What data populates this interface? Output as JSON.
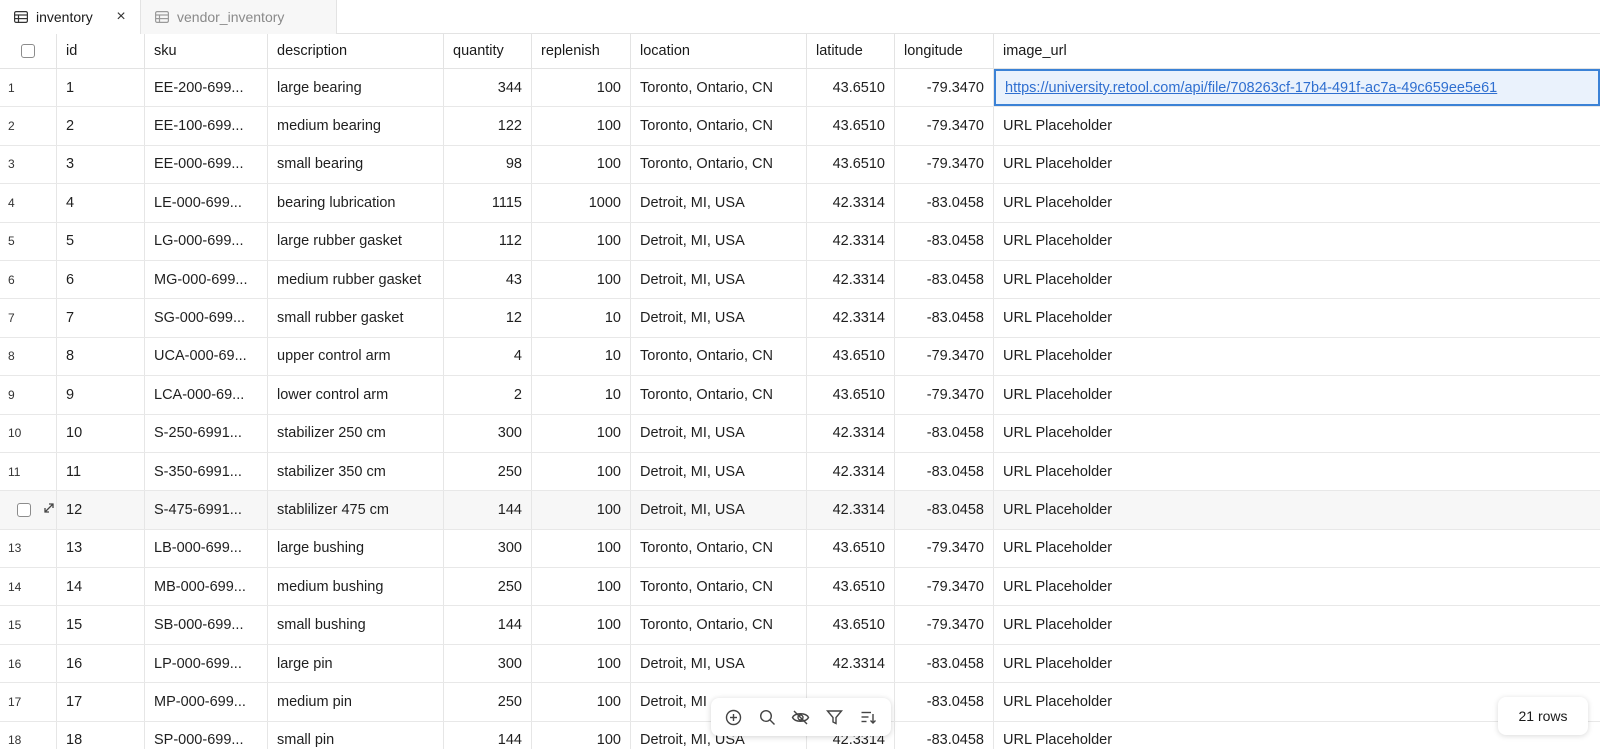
{
  "tabs": [
    {
      "label": "inventory",
      "icon": "table-icon",
      "active": true
    },
    {
      "label": "vendor_inventory",
      "icon": "table-icon",
      "active": false
    }
  ],
  "columns": [
    "id",
    "sku",
    "description",
    "quantity",
    "replenish",
    "location",
    "latitude",
    "longitude",
    "image_url"
  ],
  "rows": [
    {
      "n": "1",
      "id": "1",
      "sku": "EE-200-699...",
      "description": "large bearing",
      "quantity": "344",
      "replenish": "100",
      "location": "Toronto, Ontario, CN",
      "latitude": "43.6510",
      "longitude": "-79.3470",
      "image_url": "https://university.retool.com/api/file/708263cf-17b4-491f-ac7a-49c659ee5e61"
    },
    {
      "n": "2",
      "id": "2",
      "sku": "EE-100-699...",
      "description": "medium bearing",
      "quantity": "122",
      "replenish": "100",
      "location": "Toronto, Ontario, CN",
      "latitude": "43.6510",
      "longitude": "-79.3470",
      "image_url": "URL Placeholder"
    },
    {
      "n": "3",
      "id": "3",
      "sku": "EE-000-699...",
      "description": "small bearing",
      "quantity": "98",
      "replenish": "100",
      "location": "Toronto, Ontario, CN",
      "latitude": "43.6510",
      "longitude": "-79.3470",
      "image_url": "URL Placeholder"
    },
    {
      "n": "4",
      "id": "4",
      "sku": "LE-000-699...",
      "description": "bearing lubrication",
      "quantity": "1115",
      "replenish": "1000",
      "location": "Detroit, MI, USA",
      "latitude": "42.3314",
      "longitude": "-83.0458",
      "image_url": "URL Placeholder"
    },
    {
      "n": "5",
      "id": "5",
      "sku": "LG-000-699...",
      "description": "large rubber gasket",
      "quantity": "112",
      "replenish": "100",
      "location": "Detroit, MI, USA",
      "latitude": "42.3314",
      "longitude": "-83.0458",
      "image_url": "URL Placeholder"
    },
    {
      "n": "6",
      "id": "6",
      "sku": "MG-000-699...",
      "description": "medium rubber gasket",
      "quantity": "43",
      "replenish": "100",
      "location": "Detroit, MI, USA",
      "latitude": "42.3314",
      "longitude": "-83.0458",
      "image_url": "URL Placeholder"
    },
    {
      "n": "7",
      "id": "7",
      "sku": "SG-000-699...",
      "description": "small rubber gasket",
      "quantity": "12",
      "replenish": "10",
      "location": "Detroit, MI, USA",
      "latitude": "42.3314",
      "longitude": "-83.0458",
      "image_url": "URL Placeholder"
    },
    {
      "n": "8",
      "id": "8",
      "sku": "UCA-000-69...",
      "description": "upper control arm",
      "quantity": "4",
      "replenish": "10",
      "location": "Toronto, Ontario, CN",
      "latitude": "43.6510",
      "longitude": "-79.3470",
      "image_url": "URL Placeholder"
    },
    {
      "n": "9",
      "id": "9",
      "sku": "LCA-000-69...",
      "description": "lower control arm",
      "quantity": "2",
      "replenish": "10",
      "location": "Toronto, Ontario, CN",
      "latitude": "43.6510",
      "longitude": "-79.3470",
      "image_url": "URL Placeholder"
    },
    {
      "n": "10",
      "id": "10",
      "sku": "S-250-6991...",
      "description": "stabilizer 250 cm",
      "quantity": "300",
      "replenish": "100",
      "location": "Detroit, MI, USA",
      "latitude": "42.3314",
      "longitude": "-83.0458",
      "image_url": "URL Placeholder"
    },
    {
      "n": "11",
      "id": "11",
      "sku": "S-350-6991...",
      "description": "stabilizer 350 cm",
      "quantity": "250",
      "replenish": "100",
      "location": "Detroit, MI, USA",
      "latitude": "42.3314",
      "longitude": "-83.0458",
      "image_url": "URL Placeholder"
    },
    {
      "n": "",
      "id": "12",
      "sku": "S-475-6991...",
      "description": "stablilizer 475 cm",
      "quantity": "144",
      "replenish": "100",
      "location": "Detroit, MI, USA",
      "latitude": "42.3314",
      "longitude": "-83.0458",
      "image_url": "URL Placeholder"
    },
    {
      "n": "13",
      "id": "13",
      "sku": "LB-000-699...",
      "description": "large bushing",
      "quantity": "300",
      "replenish": "100",
      "location": "Toronto, Ontario, CN",
      "latitude": "43.6510",
      "longitude": "-79.3470",
      "image_url": "URL Placeholder"
    },
    {
      "n": "14",
      "id": "14",
      "sku": "MB-000-699...",
      "description": "medium bushing",
      "quantity": "250",
      "replenish": "100",
      "location": "Toronto, Ontario, CN",
      "latitude": "43.6510",
      "longitude": "-79.3470",
      "image_url": "URL Placeholder"
    },
    {
      "n": "15",
      "id": "15",
      "sku": "SB-000-699...",
      "description": "small bushing",
      "quantity": "144",
      "replenish": "100",
      "location": "Toronto, Ontario, CN",
      "latitude": "43.6510",
      "longitude": "-79.3470",
      "image_url": "URL Placeholder"
    },
    {
      "n": "16",
      "id": "16",
      "sku": "LP-000-699...",
      "description": "large pin",
      "quantity": "300",
      "replenish": "100",
      "location": "Detroit, MI, USA",
      "latitude": "42.3314",
      "longitude": "-83.0458",
      "image_url": "URL Placeholder"
    },
    {
      "n": "17",
      "id": "17",
      "sku": "MP-000-699...",
      "description": "medium pin",
      "quantity": "250",
      "replenish": "100",
      "location": "Detroit, MI",
      "latitude": "",
      "longitude": "-83.0458",
      "image_url": "URL Placeholder"
    },
    {
      "n": "18",
      "id": "18",
      "sku": "SP-000-699...",
      "description": "small pin",
      "quantity": "144",
      "replenish": "100",
      "location": "Detroit, MI, USA",
      "latitude": "42.3314",
      "longitude": "-83.0458",
      "image_url": "URL Placeholder"
    }
  ],
  "toolbar": {
    "tools": [
      "add-row-icon",
      "search-icon",
      "hide-columns-icon",
      "filter-icon",
      "sort-icon"
    ]
  },
  "row_count": "21 rows",
  "colors": {
    "accent": "#3b82d6",
    "link": "#2f6fd0",
    "selected_bg": "#eaf2fc",
    "border": "#e3e3e3"
  }
}
